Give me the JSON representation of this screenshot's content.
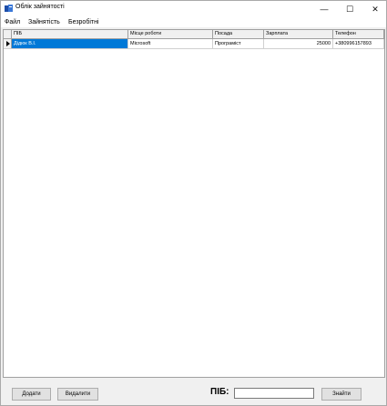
{
  "window": {
    "title": "Облік зайнятості",
    "controls": {
      "minimize": "—",
      "maximize": "☐",
      "close": "✕"
    }
  },
  "menu": {
    "items": [
      "Файл",
      "Зайнятість",
      "Безробітні"
    ]
  },
  "table": {
    "columns": [
      "ПІБ",
      "Місце роботи",
      "Посада",
      "Зарплата",
      "Телефон"
    ],
    "rows": [
      [
        "Дідюк В.І.",
        "Microsoft",
        "Програміст",
        "25000",
        "+380996157893"
      ]
    ]
  },
  "bottom": {
    "add_label": "Додати",
    "delete_label": "Видалити",
    "search_label": "ПІБ:",
    "search_value": "",
    "find_label": "Знайти"
  }
}
